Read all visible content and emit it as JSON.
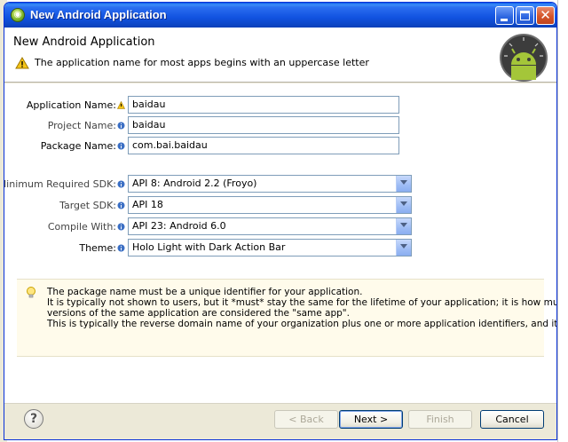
{
  "window": {
    "title": "New Android Application"
  },
  "header": {
    "title": "New Android Application",
    "message": "The application name for most apps begins with an uppercase letter",
    "warning_icon": "warning-icon",
    "logo_icon": "android-logo-icon"
  },
  "form": {
    "application_name": {
      "label": "Application Name:",
      "value": "baidau",
      "marker": "warning"
    },
    "project_name": {
      "label": "Project Name:",
      "value": "baidau",
      "marker": "info"
    },
    "package_name": {
      "label": "Package Name:",
      "value": "com.bai.baidau",
      "marker": "info"
    },
    "min_sdk": {
      "label": "Minimum Required SDK:",
      "value": "API 8: Android 2.2 (Froyo)"
    },
    "target_sdk": {
      "label": "Target SDK:",
      "value": "API 18"
    },
    "compile_with": {
      "label": "Compile With:",
      "value": "API 23: Android 6.0"
    },
    "theme": {
      "label": "Theme:",
      "value": "Holo Light with Dark Action Bar"
    }
  },
  "info": {
    "line1": "The package name must be a unique identifier for your application.",
    "line2": "It is typically not shown to users, but it *must* stay the same for the lifetime of your application; it is how multiple",
    "line3": "versions of the same application are considered the \"same app\".",
    "line4": "This is typically the reverse domain name of your organization plus one or more application identifiers, and it must be a"
  },
  "footer": {
    "help": "?",
    "back": "< Back",
    "next": "Next >",
    "finish": "Finish",
    "cancel": "Cancel"
  },
  "colors": {
    "titlebar": "#0a5ae8",
    "panel_bg": "#ece9d8",
    "info_bg": "#fffbeb"
  }
}
